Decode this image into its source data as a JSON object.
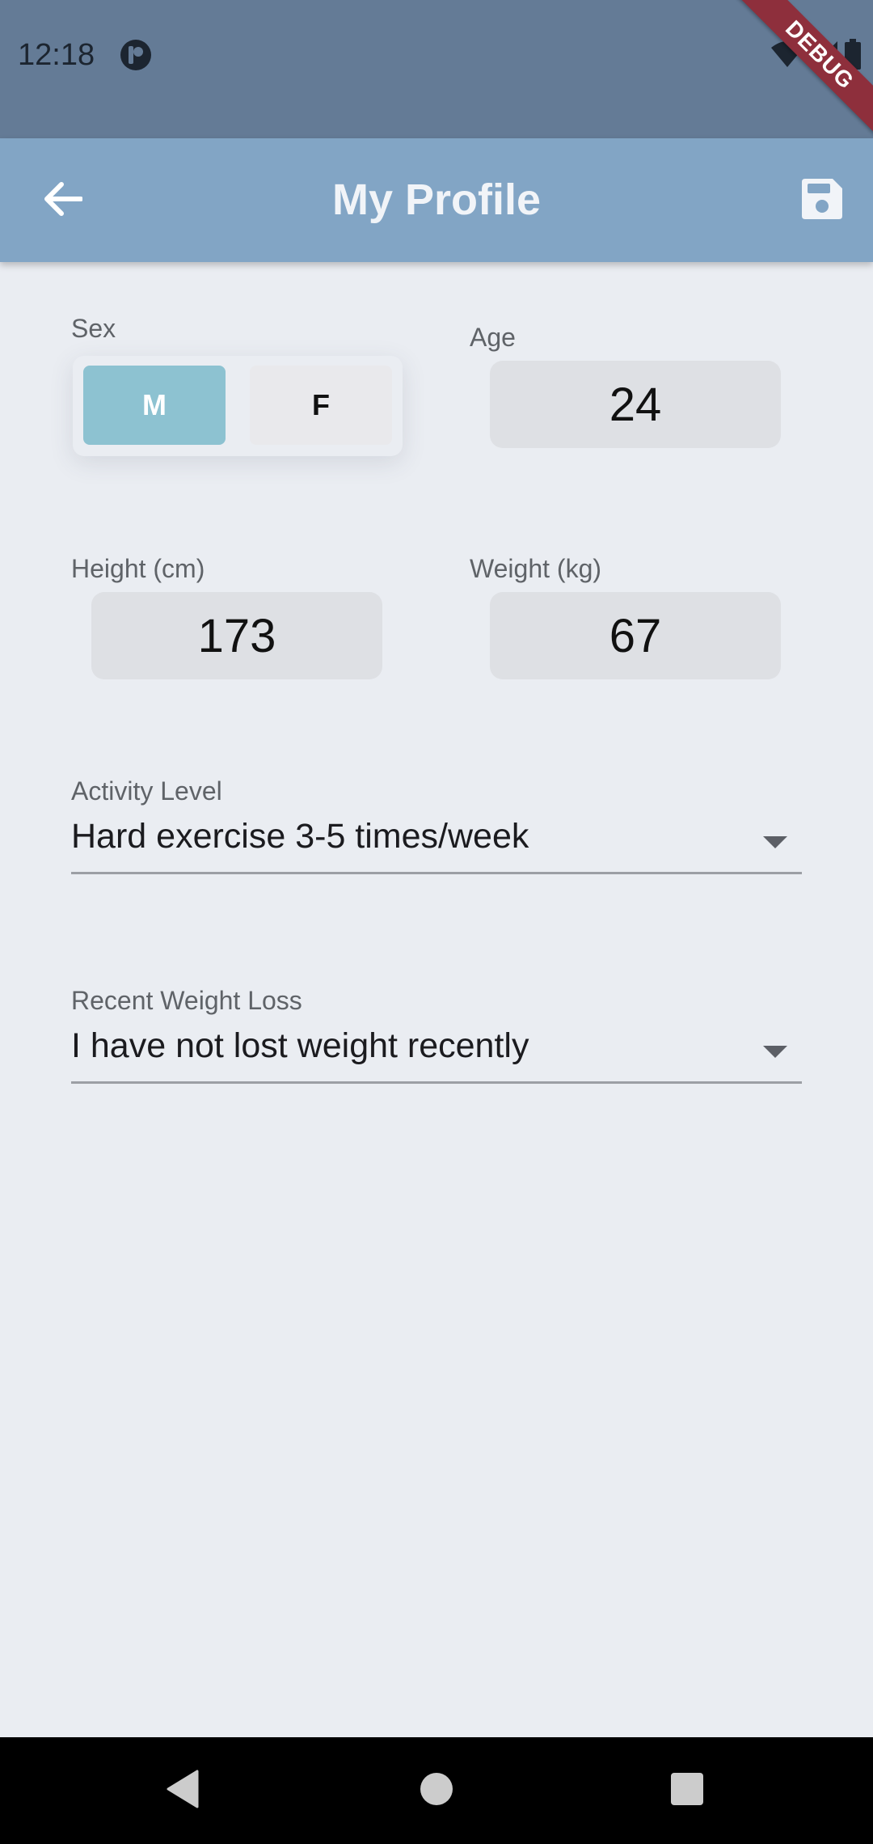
{
  "status_bar": {
    "time": "12:18",
    "app_icon": "notification-app-icon",
    "right_icons": [
      "wifi-icon",
      "signal-icon",
      "battery-icon"
    ],
    "debug_banner": "DEBUG"
  },
  "app_bar": {
    "title": "My Profile",
    "back_icon": "arrow-back-icon",
    "save_icon": "save-icon"
  },
  "profile": {
    "sex": {
      "label": "Sex",
      "options": [
        "M",
        "F"
      ],
      "selected": "M"
    },
    "age": {
      "label": "Age",
      "value": "24"
    },
    "height": {
      "label": "Height (cm)",
      "value": "173"
    },
    "weight": {
      "label": "Weight (kg)",
      "value": "67"
    },
    "activity_level": {
      "label": "Activity Level",
      "value": "Hard exercise 3-5 times/week"
    },
    "recent_weight_loss": {
      "label": "Recent Weight Loss",
      "value": "I have not lost weight recently"
    }
  },
  "nav_bar": {
    "buttons": [
      "back-triangle-icon",
      "home-circle-icon",
      "recents-square-icon"
    ]
  },
  "colors": {
    "status_bar_bg": "#647B96",
    "app_bar_bg": "#82A5C5",
    "page_bg": "#EAEDF2",
    "selected_sex_bg": "#8DC2D1",
    "input_box_bg": "#DEE0E4",
    "debug_ribbon": "#8E2F3C"
  }
}
